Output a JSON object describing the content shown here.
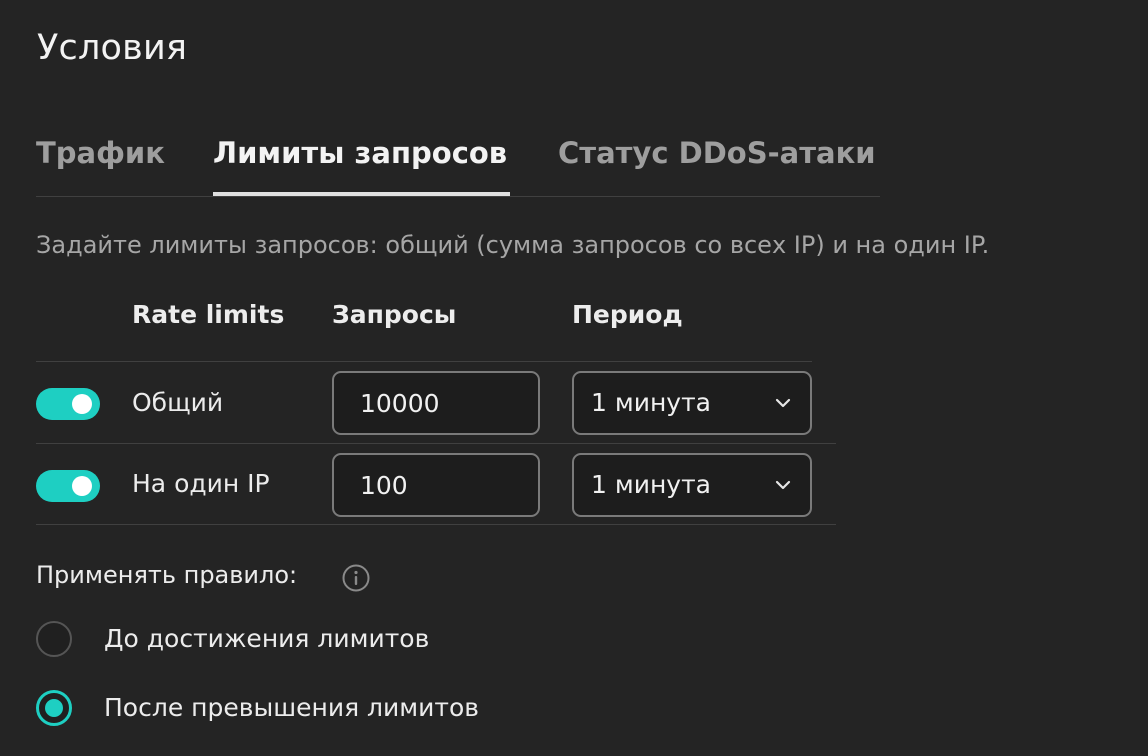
{
  "page": {
    "title": "Условия"
  },
  "tabs": [
    {
      "label": "Трафик",
      "active": false
    },
    {
      "label": "Лимиты запросов",
      "active": true
    },
    {
      "label": "Статус DDoS-атаки",
      "active": false
    }
  ],
  "description": "Задайте лимиты запросов: общий (сумма запросов со всех IP) и на один IP.",
  "table": {
    "headers": {
      "rate_limits": "Rate limits",
      "requests": "Запросы",
      "period": "Период"
    },
    "rows": [
      {
        "enabled": true,
        "label": "Общий",
        "requests": "10000",
        "period": "1 минута"
      },
      {
        "enabled": true,
        "label": "На один IP",
        "requests": "100",
        "period": "1 минута"
      }
    ]
  },
  "apply_rule": {
    "label": "Применять правило:",
    "info_icon": "info-icon",
    "options": [
      {
        "label": "До достижения лимитов",
        "selected": false
      },
      {
        "label": "После превышения лимитов",
        "selected": true
      }
    ]
  },
  "colors": {
    "background": "#242424",
    "accent": "#1ecfc2",
    "text_primary": "#f2f2f2",
    "text_secondary": "#a6a6a6",
    "border": "#7a7a7a"
  }
}
